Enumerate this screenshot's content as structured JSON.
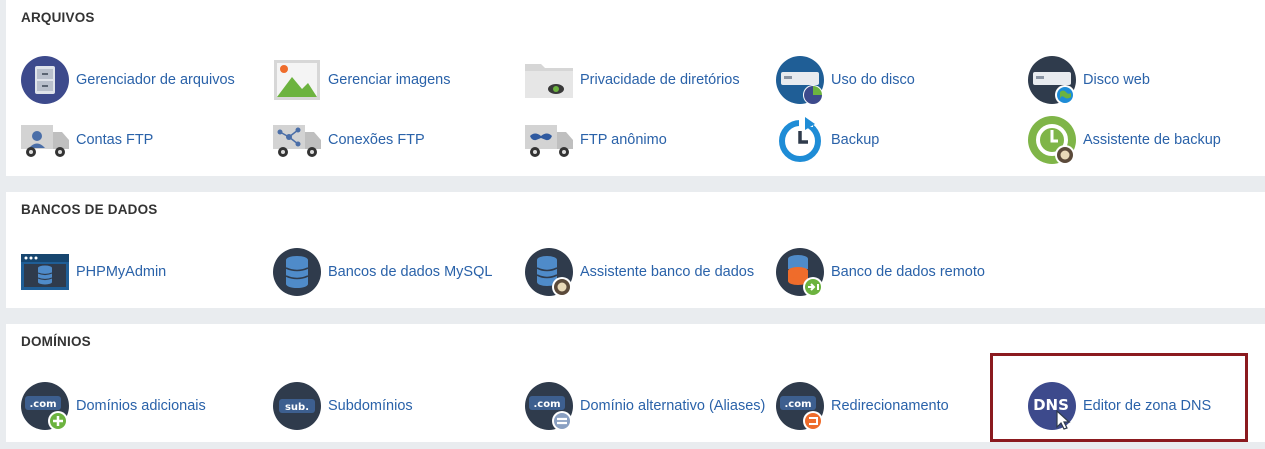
{
  "sections": [
    {
      "title": "ARQUIVOS",
      "items": [
        {
          "label": "Gerenciador de arquivos",
          "icon": "file-cabinet-icon"
        },
        {
          "label": "Gerenciar imagens",
          "icon": "image-icon"
        },
        {
          "label": "Privacidade de diretórios",
          "icon": "folder-eye-icon"
        },
        {
          "label": "Uso do disco",
          "icon": "disk-usage-icon"
        },
        {
          "label": "Disco web",
          "icon": "web-disk-icon"
        },
        {
          "label": "Contas FTP",
          "icon": "ftp-accounts-icon"
        },
        {
          "label": "Conexões FTP",
          "icon": "ftp-connections-icon"
        },
        {
          "label": "FTP anônimo",
          "icon": "anonymous-ftp-icon"
        },
        {
          "label": "Backup",
          "icon": "backup-icon"
        },
        {
          "label": "Assistente de backup",
          "icon": "backup-wizard-icon"
        }
      ]
    },
    {
      "title": "BANCOS DE DADOS",
      "items": [
        {
          "label": "PHPMyAdmin",
          "icon": "phpmyadmin-icon"
        },
        {
          "label": "Bancos de dados MySQL",
          "icon": "mysql-database-icon"
        },
        {
          "label": "Assistente banco de dados",
          "icon": "database-wizard-icon"
        },
        {
          "label": "Banco de dados remoto",
          "icon": "remote-database-icon"
        }
      ]
    },
    {
      "title": "DOMÍNIOS",
      "items": [
        {
          "label": "Domínios adicionais",
          "icon": "addon-domains-icon",
          "icon_text": ".com"
        },
        {
          "label": "Subdomínios",
          "icon": "subdomains-icon",
          "icon_text": "sub."
        },
        {
          "label": "Domínio alternativo (Aliases)",
          "icon": "aliases-icon",
          "icon_text": ".com"
        },
        {
          "label": "Redirecionamento",
          "icon": "redirects-icon",
          "icon_text": ".com"
        },
        {
          "label": "Editor de zona DNS",
          "icon": "dns-zone-editor-icon",
          "icon_text": "DNS"
        }
      ]
    }
  ],
  "colors": {
    "link": "#2a62a9",
    "highlight_border": "#8b1a1f",
    "icon_dark": "#2f3b4c",
    "icon_blue": "#1e8cd6",
    "icon_green": "#6cb33f",
    "icon_orange": "#ef6c2b"
  }
}
